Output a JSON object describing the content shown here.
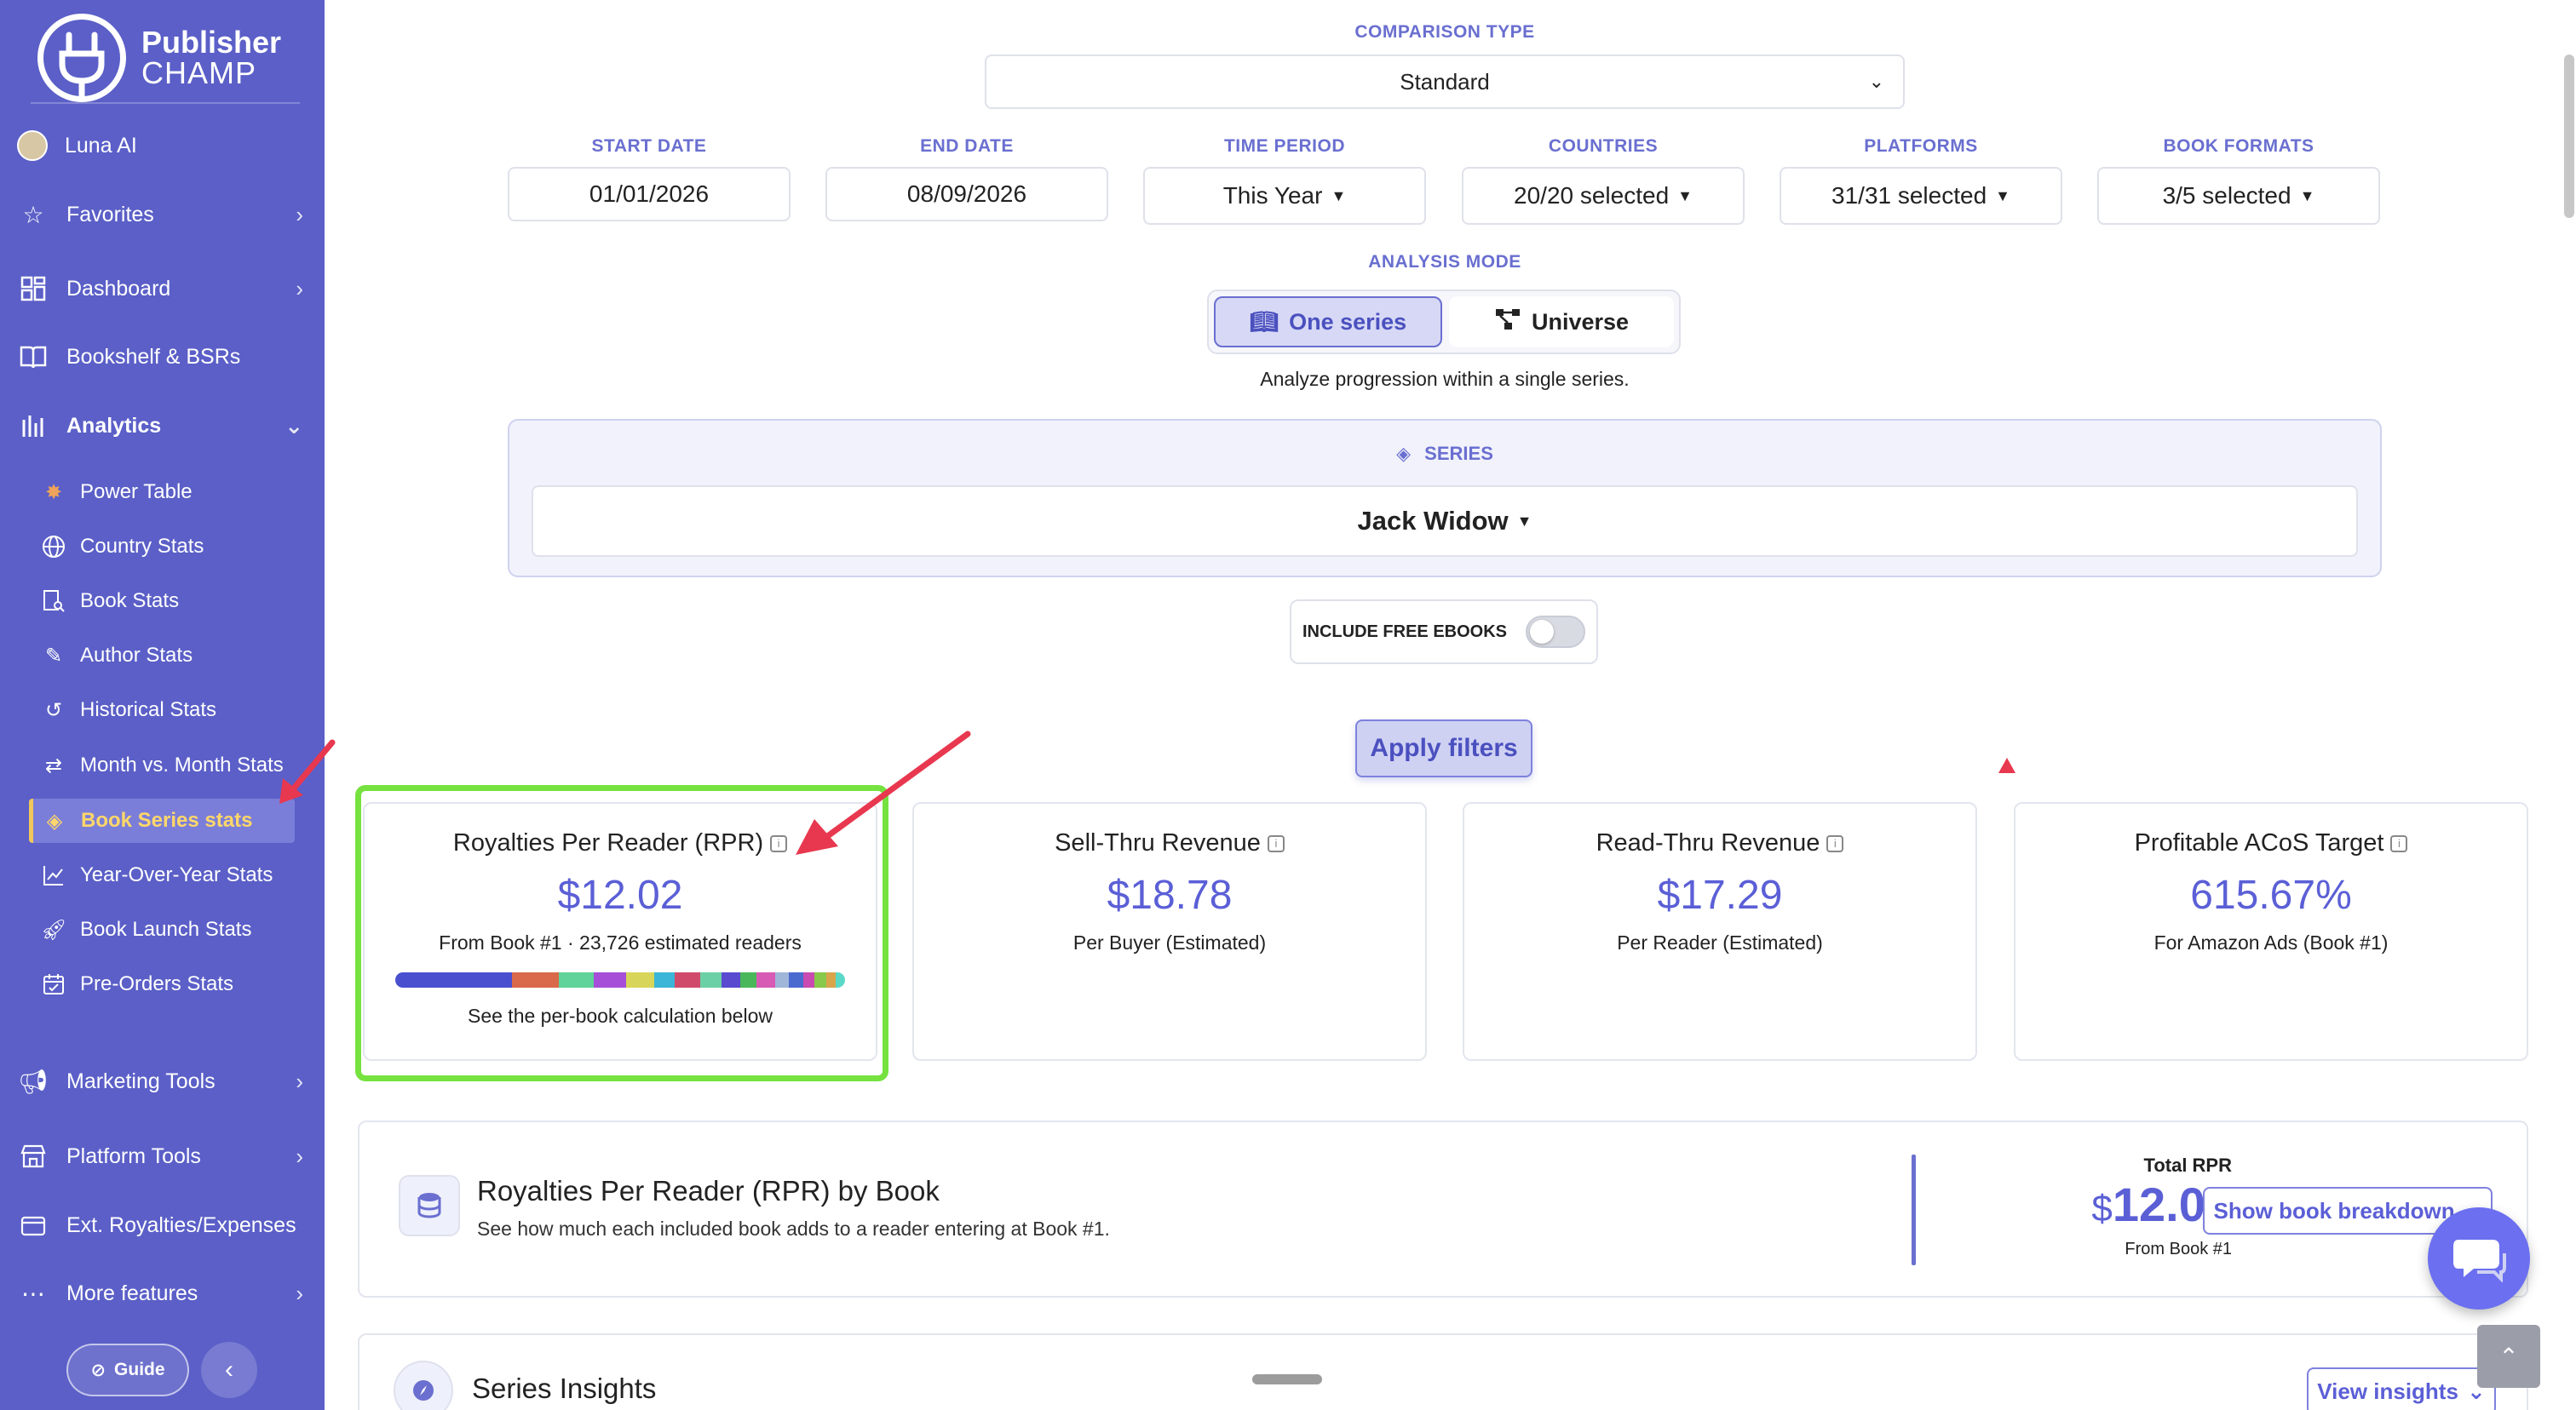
{
  "brand": {
    "name_line1": "Publisher",
    "name_line2": "CHAMP"
  },
  "user": {
    "name": "Luna AI"
  },
  "sidebar": {
    "items": [
      {
        "label": "Favorites"
      },
      {
        "label": "Dashboard"
      },
      {
        "label": "Bookshelf & BSRs"
      },
      {
        "label": "Analytics"
      },
      {
        "label": "Marketing Tools"
      },
      {
        "label": "Platform Tools"
      },
      {
        "label": "Ext. Royalties/Expenses"
      },
      {
        "label": "More features"
      }
    ],
    "analytics_items": [
      {
        "label": "Power Table"
      },
      {
        "label": "Country Stats"
      },
      {
        "label": "Book Stats"
      },
      {
        "label": "Author Stats"
      },
      {
        "label": "Historical Stats"
      },
      {
        "label": "Month vs. Month Stats"
      },
      {
        "label": "Book Series stats"
      },
      {
        "label": "Year-Over-Year Stats"
      },
      {
        "label": "Book Launch Stats"
      },
      {
        "label": "Pre-Orders Stats"
      }
    ],
    "guide_label": "Guide"
  },
  "filters": {
    "comparison_type": {
      "label": "COMPARISON TYPE",
      "value": "Standard"
    },
    "start_date": {
      "label": "START DATE",
      "value": "01/01/2026"
    },
    "end_date": {
      "label": "END DATE",
      "value": "08/09/2026"
    },
    "time_period": {
      "label": "TIME PERIOD",
      "value": "This Year"
    },
    "countries": {
      "label": "COUNTRIES",
      "value": "20/20 selected"
    },
    "platforms": {
      "label": "PLATFORMS",
      "value": "31/31 selected"
    },
    "book_formats": {
      "label": "BOOK FORMATS",
      "value": "3/5 selected"
    }
  },
  "analysis_mode": {
    "label": "ANALYSIS MODE",
    "options": [
      "One series",
      "Universe"
    ],
    "selected": "One series",
    "description": "Analyze progression within a single series."
  },
  "series": {
    "label": "SERIES",
    "value": "Jack Widow"
  },
  "include_free_ebooks": {
    "label": "INCLUDE FREE EBOOKS",
    "enabled": false
  },
  "apply_label": "Apply filters",
  "cards": [
    {
      "title": "Royalties Per Reader (RPR)",
      "value": "$12.02",
      "sub": "From Book #1 · 23,726 estimated readers",
      "note": "See the per-book calculation below"
    },
    {
      "title": "Sell-Thru Revenue",
      "value": "$18.78",
      "sub": "Per Buyer (Estimated)"
    },
    {
      "title": "Read-Thru Revenue",
      "value": "$17.29",
      "sub": "Per Reader (Estimated)"
    },
    {
      "title": "Profitable ACoS Target",
      "value": "615.67%",
      "sub": "For Amazon Ads (Book #1)"
    }
  ],
  "rpr_bar_colors": [
    "#4a4fd0",
    "#d9694a",
    "#5fd39a",
    "#a64ed8",
    "#d7d65a",
    "#3bb5d8",
    "#d04a6c",
    "#6bd0a5",
    "#5a4ad0",
    "#4ab85a",
    "#d75ab5",
    "#9fb6d9",
    "#4a6ad0",
    "#c94ab0",
    "#88c84a",
    "#d9a54a",
    "#5ad9c9"
  ],
  "rpr_by_book": {
    "title": "Royalties Per Reader (RPR) by Book",
    "description": "See how much each included book adds to a reader entering at Book #1.",
    "total_label": "Total RPR",
    "total_value": "12.02",
    "total_currency": "$",
    "total_sub": "From Book #1",
    "button": "Show book breakdown"
  },
  "insights": {
    "title": "Series Insights",
    "button": "View insights"
  },
  "colors": {
    "sidebar": "#5b5fc7",
    "accent": "#5b5fd6",
    "highlight": "#76e23f",
    "annotation_arrow": "#e8384f"
  }
}
